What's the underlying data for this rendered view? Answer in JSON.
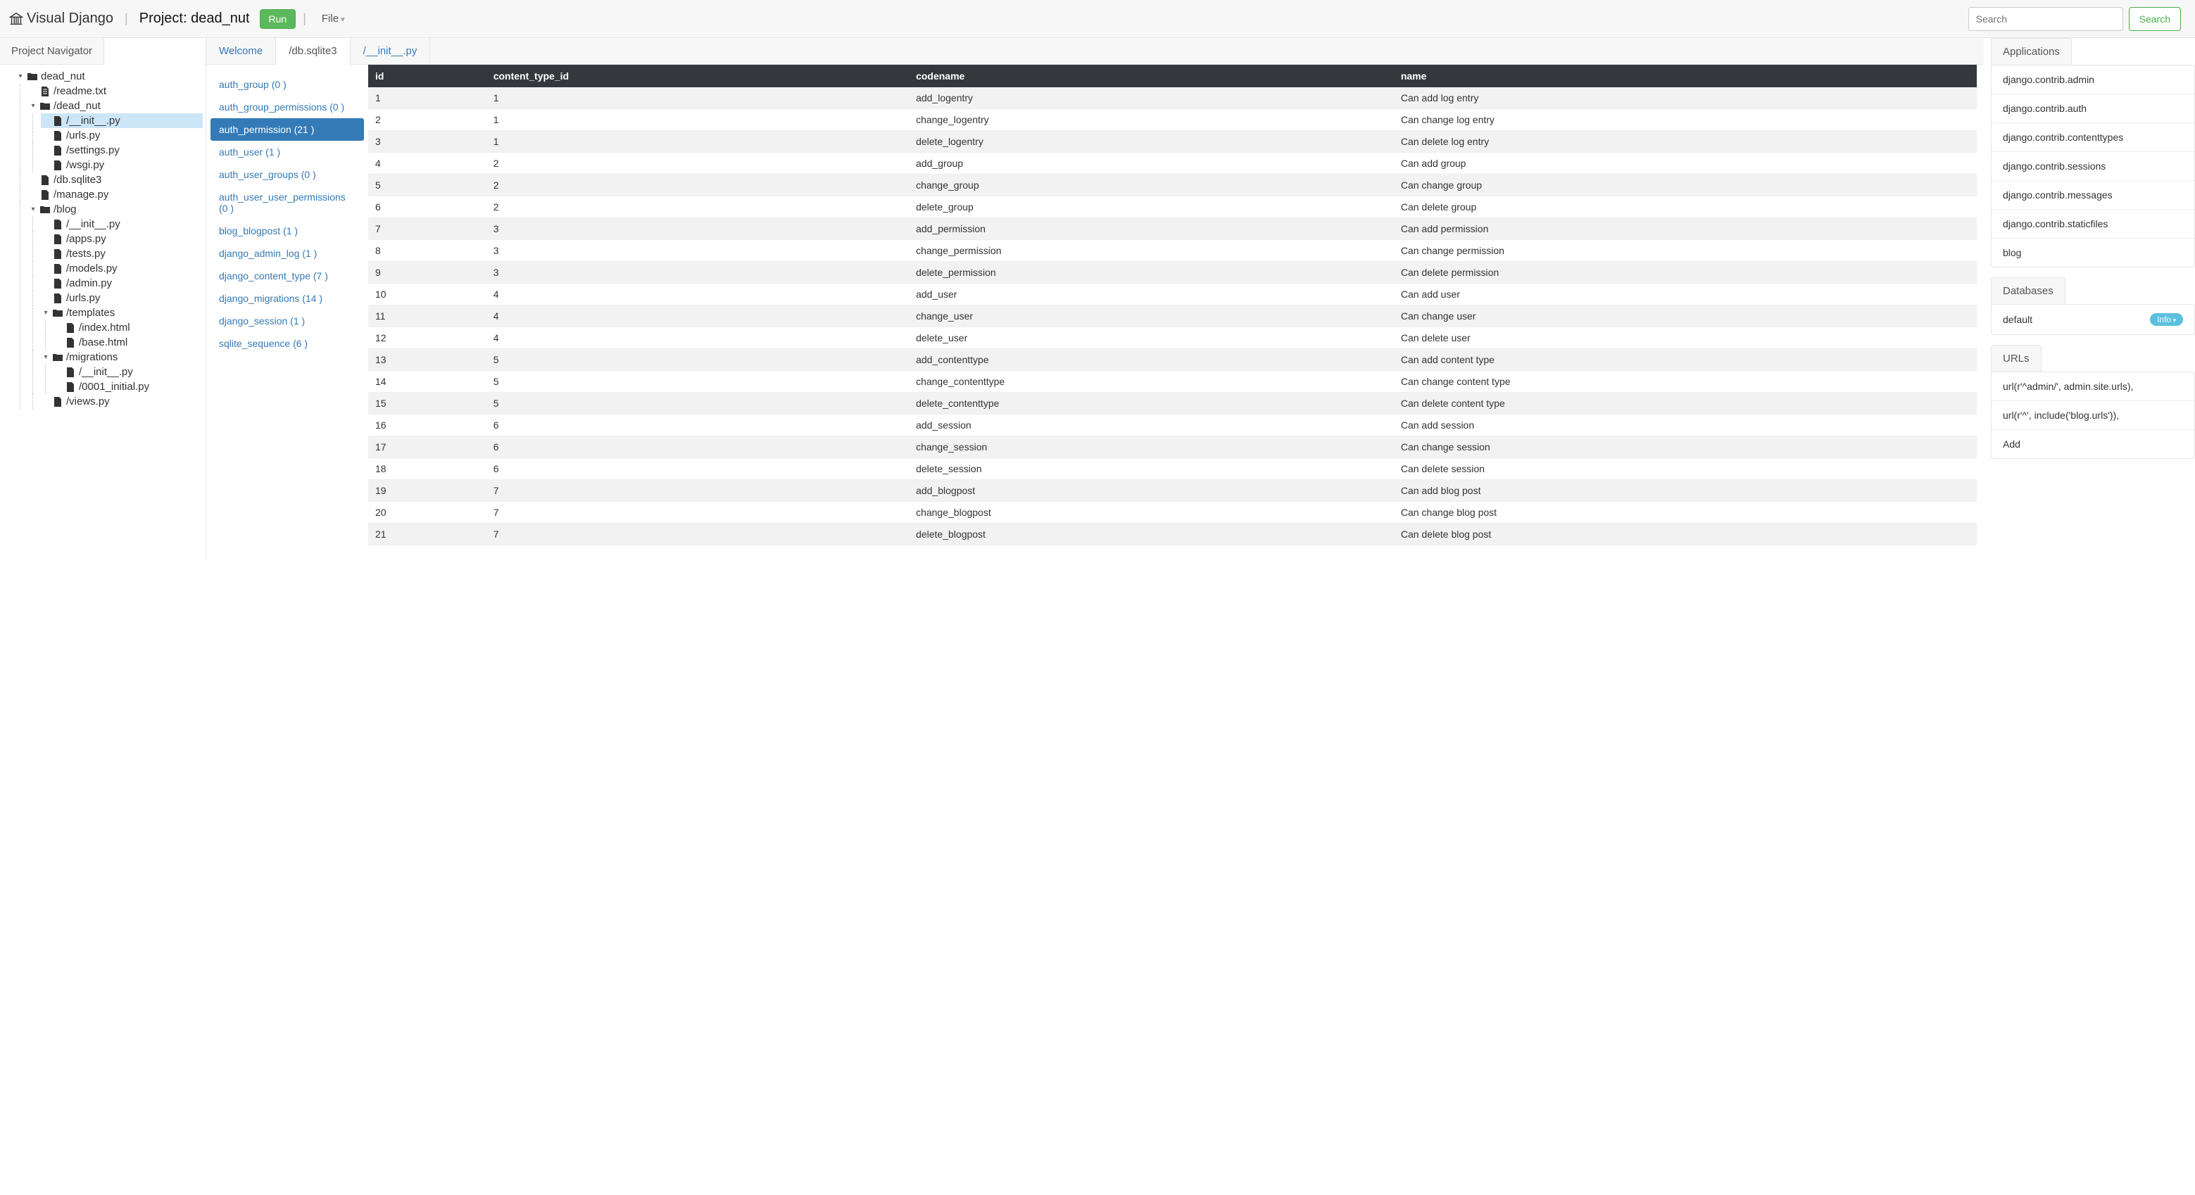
{
  "header": {
    "brand": "Visual Django",
    "project_label": "Project: dead_nut",
    "run_label": "Run",
    "file_label": "File",
    "search_placeholder": "Search",
    "search_button": "Search"
  },
  "left_tab": "Project Navigator",
  "tree": {
    "root": "dead_nut",
    "n0": "/readme.txt",
    "n1": "/dead_nut",
    "n1_0": "/__init__.py",
    "n1_1": "/urls.py",
    "n1_2": "/settings.py",
    "n1_3": "/wsgi.py",
    "n2": "/db.sqlite3",
    "n3": "/manage.py",
    "n4": "/blog",
    "n4_0": "/__init__.py",
    "n4_1": "/apps.py",
    "n4_2": "/tests.py",
    "n4_3": "/models.py",
    "n4_4": "/admin.py",
    "n4_5": "/urls.py",
    "n4_6": "/templates",
    "n4_6_0": "/index.html",
    "n4_6_1": "/base.html",
    "n4_7": "/migrations",
    "n4_7_0": "/__init__.py",
    "n4_7_1": "/0001_initial.py",
    "n4_8": "/views.py"
  },
  "center_tabs": {
    "t0": "Welcome",
    "t1": "/db.sqlite3",
    "t2": "/__init__.py"
  },
  "db_tables": {
    "t0": "auth_group (0 )",
    "t1": "auth_group_permissions (0 )",
    "t2": "auth_permission (21 )",
    "t3": "auth_user (1 )",
    "t4": "auth_user_groups (0 )",
    "t5": "auth_user_user_permissions (0 )",
    "t6": "blog_blogpost (1 )",
    "t7": "django_admin_log (1 )",
    "t8": "django_content_type (7 )",
    "t9": "django_migrations (14 )",
    "t10": "django_session (1 )",
    "t11": "sqlite_sequence (6 )"
  },
  "columns": {
    "c0": "id",
    "c1": "content_type_id",
    "c2": "codename",
    "c3": "name"
  },
  "rows": [
    {
      "c0": "1",
      "c1": "1",
      "c2": "add_logentry",
      "c3": "Can add log entry"
    },
    {
      "c0": "2",
      "c1": "1",
      "c2": "change_logentry",
      "c3": "Can change log entry"
    },
    {
      "c0": "3",
      "c1": "1",
      "c2": "delete_logentry",
      "c3": "Can delete log entry"
    },
    {
      "c0": "4",
      "c1": "2",
      "c2": "add_group",
      "c3": "Can add group"
    },
    {
      "c0": "5",
      "c1": "2",
      "c2": "change_group",
      "c3": "Can change group"
    },
    {
      "c0": "6",
      "c1": "2",
      "c2": "delete_group",
      "c3": "Can delete group"
    },
    {
      "c0": "7",
      "c1": "3",
      "c2": "add_permission",
      "c3": "Can add permission"
    },
    {
      "c0": "8",
      "c1": "3",
      "c2": "change_permission",
      "c3": "Can change permission"
    },
    {
      "c0": "9",
      "c1": "3",
      "c2": "delete_permission",
      "c3": "Can delete permission"
    },
    {
      "c0": "10",
      "c1": "4",
      "c2": "add_user",
      "c3": "Can add user"
    },
    {
      "c0": "11",
      "c1": "4",
      "c2": "change_user",
      "c3": "Can change user"
    },
    {
      "c0": "12",
      "c1": "4",
      "c2": "delete_user",
      "c3": "Can delete user"
    },
    {
      "c0": "13",
      "c1": "5",
      "c2": "add_contenttype",
      "c3": "Can add content type"
    },
    {
      "c0": "14",
      "c1": "5",
      "c2": "change_contenttype",
      "c3": "Can change content type"
    },
    {
      "c0": "15",
      "c1": "5",
      "c2": "delete_contenttype",
      "c3": "Can delete content type"
    },
    {
      "c0": "16",
      "c1": "6",
      "c2": "add_session",
      "c3": "Can add session"
    },
    {
      "c0": "17",
      "c1": "6",
      "c2": "change_session",
      "c3": "Can change session"
    },
    {
      "c0": "18",
      "c1": "6",
      "c2": "delete_session",
      "c3": "Can delete session"
    },
    {
      "c0": "19",
      "c1": "7",
      "c2": "add_blogpost",
      "c3": "Can add blog post"
    },
    {
      "c0": "20",
      "c1": "7",
      "c2": "change_blogpost",
      "c3": "Can change blog post"
    },
    {
      "c0": "21",
      "c1": "7",
      "c2": "delete_blogpost",
      "c3": "Can delete blog post"
    }
  ],
  "right": {
    "apps_tab": "Applications",
    "apps": {
      "a0": "django.contrib.admin",
      "a1": "django.contrib.auth",
      "a2": "django.contrib.contenttypes",
      "a3": "django.contrib.sessions",
      "a4": "django.contrib.messages",
      "a5": "django.contrib.staticfiles",
      "a6": "blog"
    },
    "db_tab": "Databases",
    "db_item": "default",
    "db_badge": "Info",
    "urls_tab": "URLs",
    "urls": {
      "u0": "url(r'^admin/', admin.site.urls),",
      "u1": "url(r'^', include('blog.urls')),",
      "u2": "Add"
    }
  }
}
